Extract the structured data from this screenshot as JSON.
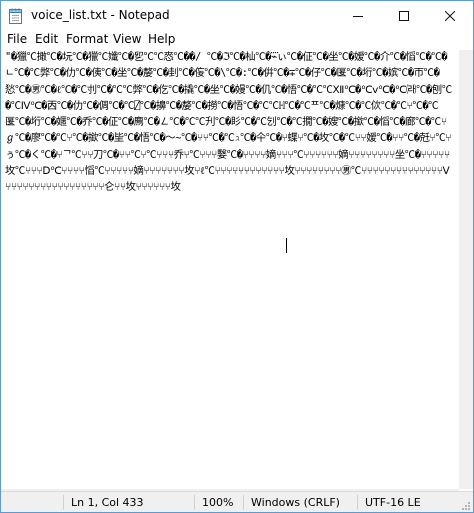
{
  "window": {
    "title": "voice_list.txt - Notepad",
    "icons": {
      "app": "notepad-icon",
      "minimize": "minimize-icon",
      "maximize": "maximize-icon",
      "close": "close-icon"
    }
  },
  "menu": {
    "file": "File",
    "edit": "Edit",
    "format": "Format",
    "view": "View",
    "help": "Help"
  },
  "editor": {
    "content": "\"�獵℃撖℃�坃℃�獵℃孅℃�乮℃℃㤲℃��/ ℃�ℑ℃�杣℃�⌁⃜ぃ℃�佂℃�坐℃�嫒℃�介℃�慆℃�℃�ㄴ℃�℃弊℃�仂℃�侇℃�坐℃�嫠℃�刲℃�侫℃�\\℃�꞉℃�倂℃�∓℃�仔℃�匽℃�垳℃�嫔℃�帀℃�悐℃�㊚℃�ℓ℃�℃刌℃�℃℃弊℃�仡℃�撬℃�坐℃�嫚℃�仉℃�悟℃�℃℃Ⅻ℃�℃ⅴ℃�℃㈑℃�刨℃�℃Ⅳ℃�㐁℃�仂℃�倜℃�℃⍁℃�擤℃�嫠℃�撈℃�悟℃�℃℃ℍ℃�℃ᄑ℃�𤎖℃�℃佽℃�℃⑂℃�℃匽℃�垳℃�嫟℃�乔℃�佂℃�廌℃�㇜℃�℃℃刋℃�䀐℃�℃刉℃�℃撊℃�嫂℃�撳℃�慆℃�廊℃�℃⑂ℊ℃�廖℃�℃⑂℃�撳℃�坒℃�悟℃�〜∼℃�⑂⑂℃�℃ℷ℃�仐℃�⑂蝶⑂℃�坆℃�℃⑂⑂嫒℃�⑂⑂℃�兛⑂℃⑂ぅ℃�く℃�⑂ᄀ℃⑂⑂刀℃�⑂⑂℃⑂℃⑂⑂⑂乔⑂℃⑂⑂⑂嫛℃�⑂⑂⑂⑂嫡⑂⑂⑂℃⑂⑂⑂⑂⑂⑂嫡⑂⑂⑂⑂⑂⑂⑂⑂坐℃�⑂⑂⑂⑂⑂坆℃⑂⑂⑂Ⅾ℃⑂⑂⑂⑂慆℃⑂⑂⑂⑂⑂嫡⑂⑂⑂⑂⑂⑂⑂坆⑂ℓ℃⑂⑂⑂⑂⑂⑂⑂⑂⑂⑂⑂⑂坆⑂⑂⑂⑂⑂⑂⑂⑂㊚℃⑂⑂⑂⑂⑂⑂⑂⑂⑂⑂⑂⑂⑂⑂Ⅴ⑂⑂⑂⑂⑂⑂⑂⑂⑂⑂⑂⑂⑂⑂⑂⑂⑂仑⑂⑂坆⑂⑂⑂⑂⑂⑂坆"
  },
  "status": {
    "position": "Ln 1, Col 433",
    "zoom": "100%",
    "line_ending": "Windows (CRLF)",
    "encoding": "UTF-16 LE"
  },
  "colors": {
    "window_border": "#5a9bd5",
    "status_bg": "#f0f0f0"
  }
}
